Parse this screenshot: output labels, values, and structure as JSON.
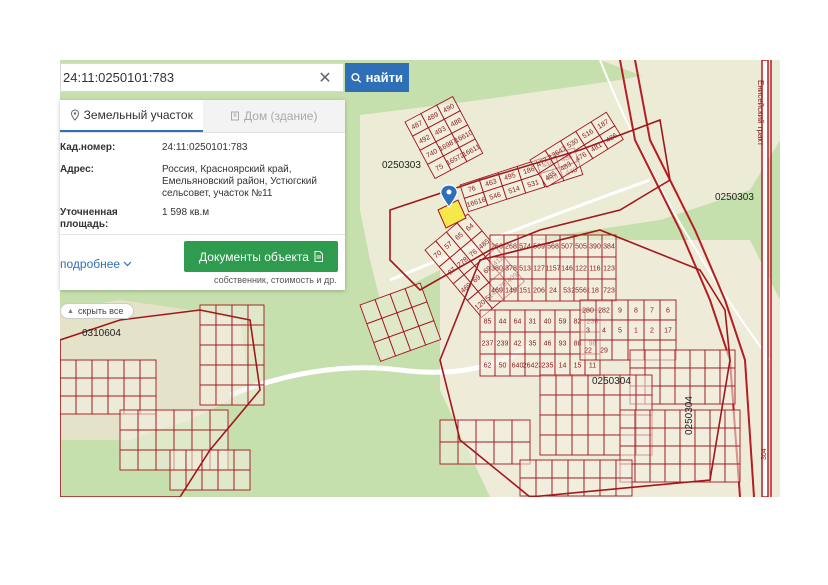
{
  "search": {
    "value": "24:11:0250101:783",
    "button_label": "найти"
  },
  "panel": {
    "tab_land": "Земельный участок",
    "tab_house": "Дом (здание)",
    "cad_label": "Кад.номер:",
    "cad_value": "24:11:0250101:783",
    "address_label": "Адрес:",
    "address_value": "Россия, Красноярский край, Емельяновский район, Устюгский сельсовет, участок №11",
    "area_label_1": "Уточненная",
    "area_label_2": "площадь:",
    "area_value": "1 598 кв.м",
    "more_link": "подробнее",
    "docs_button": "Документы объекта",
    "docs_sub": "собственник, стоимость и др."
  },
  "hide_all": "скрыть все",
  "quarters": [
    "0250303",
    "0250303",
    "0250304",
    "0250304",
    "0310604"
  ],
  "road_labels": [
    "Енисейский тракт",
    "304"
  ],
  "plot_labels": [
    "487",
    "489",
    "490",
    "492",
    "493",
    "488",
    "740",
    "16987",
    "16610",
    "75",
    "16572",
    "16611",
    "76",
    "463",
    "495",
    "186",
    "446",
    "486",
    "16616",
    "546",
    "514",
    "531",
    "448",
    "440",
    "477",
    "12647",
    "530",
    "516",
    "187",
    "485",
    "483",
    "476",
    "481",
    "486",
    "70",
    "57",
    "65",
    "64",
    "87",
    "278",
    "76",
    "485",
    "469",
    "69",
    "69",
    "411",
    "120",
    "514",
    "575",
    "409",
    "266",
    "268",
    "574",
    "569",
    "568",
    "507",
    "505",
    "390",
    "384",
    "380",
    "378",
    "513",
    "127",
    "1157",
    "146",
    "122",
    "116",
    "123",
    "469",
    "149",
    "151",
    "206",
    "24",
    "53",
    "25561",
    "18",
    "723",
    "85",
    "44",
    "64",
    "31",
    "40",
    "59",
    "82",
    "236",
    "237",
    "239",
    "42",
    "35",
    "46",
    "93",
    "88",
    "98",
    "62",
    "50",
    "640",
    "26423",
    "235",
    "14",
    "15",
    "11",
    "280",
    "282",
    "9",
    "8",
    "7",
    "6",
    "3",
    "4",
    "5",
    "1",
    "2",
    "17",
    "22",
    "29"
  ],
  "colors": {
    "map_green": "#c6e0ad",
    "plot_border": "#a3161c",
    "selected_plot": "#f5e84a",
    "button_blue": "#2e6fb8",
    "docs_green": "#2e9b4f"
  }
}
